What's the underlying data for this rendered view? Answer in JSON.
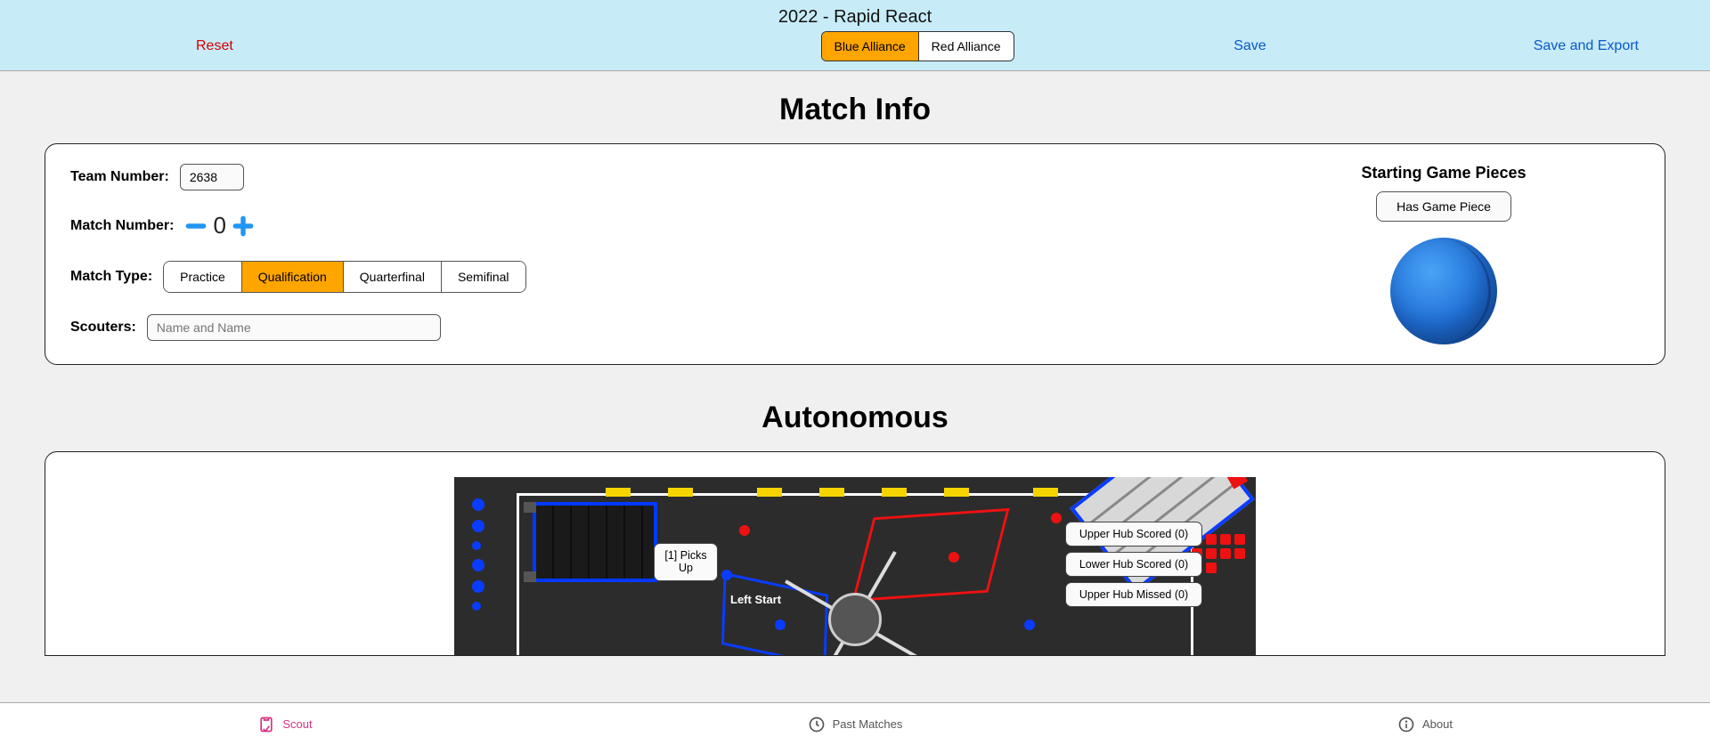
{
  "header": {
    "title": "2022 - Rapid React",
    "reset": "Reset",
    "save": "Save",
    "save_export": "Save and Export",
    "alliance": {
      "blue": "Blue Alliance",
      "red": "Red Alliance",
      "active": "blue"
    }
  },
  "match_info": {
    "heading": "Match Info",
    "team_label": "Team Number:",
    "team_value": "2638",
    "match_number_label": "Match Number:",
    "match_number_value": "0",
    "match_type_label": "Match Type:",
    "match_types": [
      "Practice",
      "Qualification",
      "Quarterfinal",
      "Semifinal"
    ],
    "match_type_active": "Qualification",
    "scouters_label": "Scouters:",
    "scouters_placeholder": "Name and Name",
    "starting_pieces_label": "Starting Game Pieces",
    "has_game_piece": "Has Game Piece"
  },
  "autonomous": {
    "heading": "Autonomous",
    "picks_up": "[1] Picks Up",
    "left_start": "Left Start",
    "upper_scored": "Upper Hub Scored (0)",
    "lower_scored": "Lower Hub Scored (0)",
    "upper_missed": "Upper Hub Missed (0)"
  },
  "footer": {
    "scout": "Scout",
    "past": "Past Matches",
    "about": "About"
  }
}
